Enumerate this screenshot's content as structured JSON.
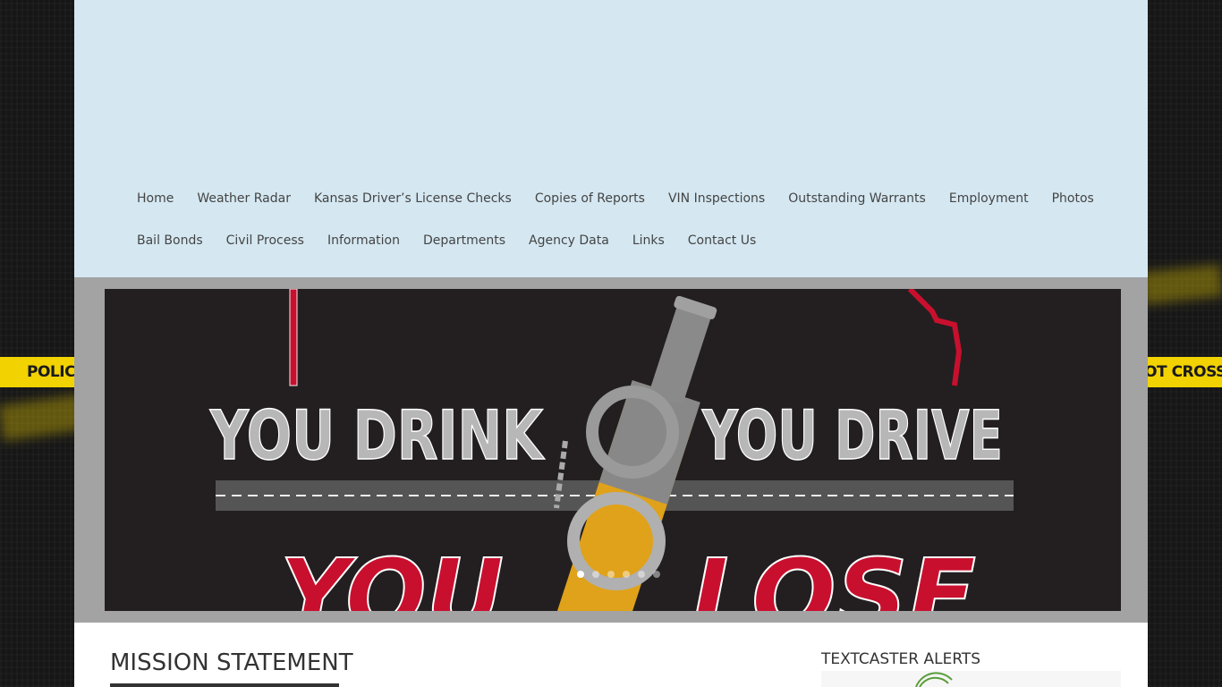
{
  "nav": {
    "row1": [
      "Home",
      "Weather Radar",
      "Kansas Driver’s License Checks",
      "Copies of Reports",
      "VIN Inspections",
      "Outstanding Warrants",
      "Employment",
      "Photos"
    ],
    "row2": [
      "Bail Bonds",
      "Civil Process",
      "Information",
      "Departments",
      "Agency Data",
      "Links",
      "Contact Us"
    ]
  },
  "background": {
    "tape_left": "POLICE LI",
    "tape_right": "O NOT CROSS"
  },
  "slider": {
    "line1_left": "YOU DRINK",
    "line1_right": "YOU DRIVE",
    "line2_left": "YOU",
    "line2_right": "LOSE",
    "slide_count": 6,
    "active_index": 0
  },
  "mission": {
    "title": "MISSION STATEMENT"
  },
  "sidebar": {
    "alerts_title": "TEXTCASTER ALERTS"
  },
  "colors": {
    "header_bg": "#d5e8f2",
    "tape_yellow": "#f2d200",
    "slogan_red": "#c8102e"
  }
}
